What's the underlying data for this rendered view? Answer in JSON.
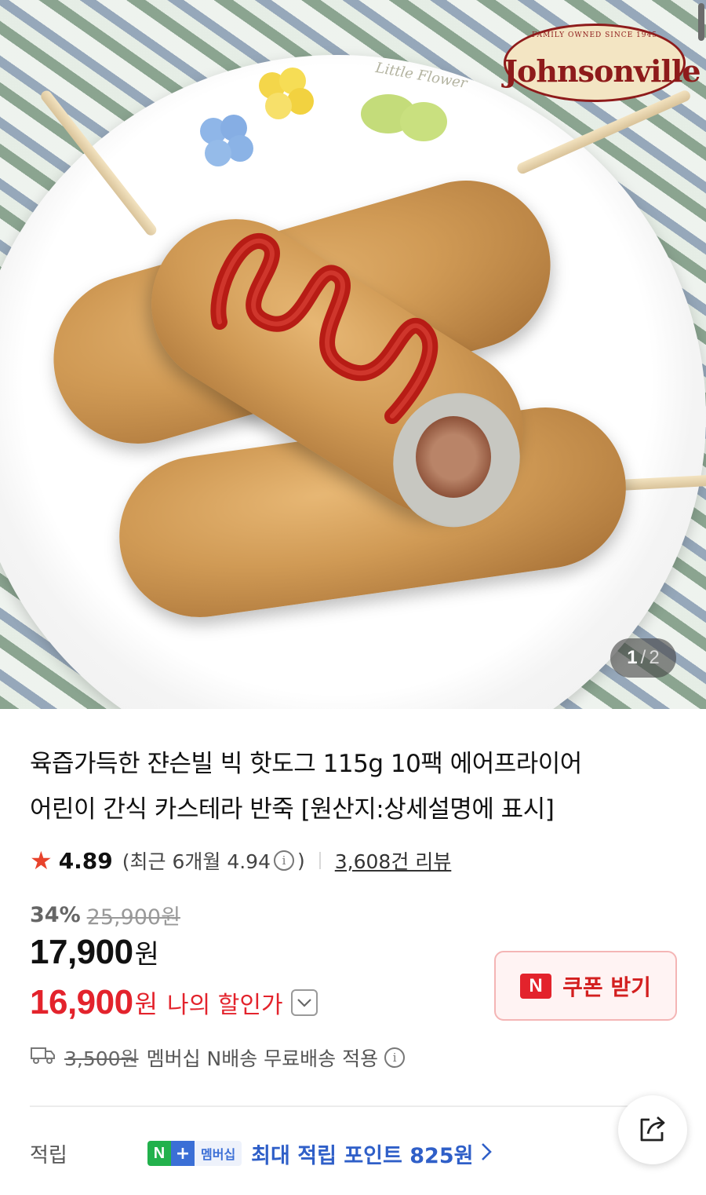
{
  "gallery": {
    "brand_logo_text": "Johnsonville",
    "brand_logo_arch": "FAMILY OWNED SINCE 1945",
    "plate_text": "Little Flower",
    "counter_current": "1",
    "counter_separator": "/",
    "counter_total": "2"
  },
  "product": {
    "title_line1": "육즙가득한 쟌슨빌 빅 핫도그 115g 10팩 에어프라이어",
    "title_line2": "어린이 간식 카스테라 반죽 [원산지:상세설명에 표시]"
  },
  "rating": {
    "star_icon": "star-icon",
    "score": "4.89",
    "recent_prefix": "(최근 6개월 4.94",
    "recent_suffix": ")",
    "review_count": "3,608건 리뷰"
  },
  "price": {
    "discount_rate": "34%",
    "original_price": "25,900원",
    "sale_price": "17,900",
    "sale_unit": "원",
    "my_price": "16,900",
    "my_price_unit": "원",
    "my_price_label": "나의 할인가"
  },
  "coupon": {
    "badge": "N",
    "label": "쿠폰 받기"
  },
  "shipping": {
    "old_fee": "3,500원",
    "text": "멤버십 N배송 무료배송 적용"
  },
  "points": {
    "label": "적립",
    "badge_n": "N",
    "badge_plus": "+",
    "badge_membership": "멤버십",
    "text": "최대 적립 포인트 825원"
  },
  "colors": {
    "accent_red": "#e3232c",
    "star": "#e8432c",
    "points_blue": "#2f5fc8",
    "naver_green": "#22b14c"
  }
}
